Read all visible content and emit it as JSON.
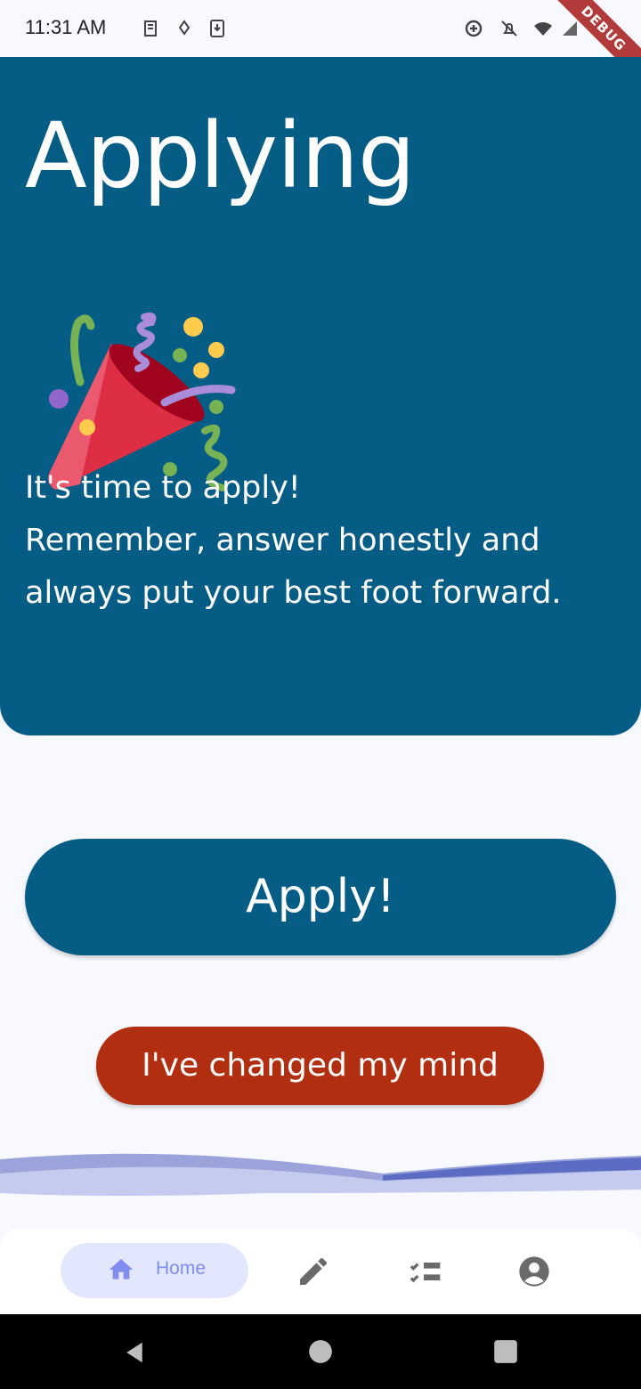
{
  "status_bar": {
    "time": "11:31 AM",
    "debug_label": "DEBUG"
  },
  "hero": {
    "title": "Applying",
    "lines": [
      "It's time to apply!",
      "Remember, answer honestly and",
      "always put your best foot forward."
    ],
    "background_color": "#055c85"
  },
  "actions": {
    "apply_label": "Apply!",
    "apply_color": "#055c85",
    "cancel_label": "I've changed my mind",
    "cancel_color": "#b12e10"
  },
  "bottom_nav": {
    "items": [
      {
        "label": "Home",
        "icon": "home-icon",
        "selected": true
      },
      {
        "icon": "edit-icon"
      },
      {
        "icon": "checklist-icon"
      },
      {
        "icon": "account-icon"
      }
    ]
  },
  "system_nav": {
    "icons": [
      "back-icon",
      "home-circle-icon",
      "recents-icon"
    ]
  }
}
